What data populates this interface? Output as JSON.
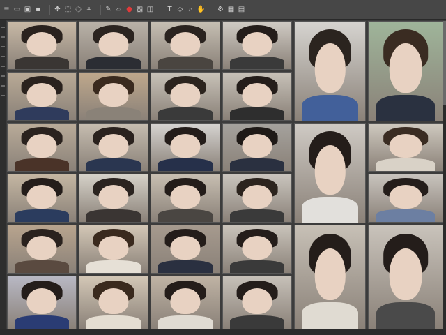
{
  "toolbar": {
    "groups": [
      {
        "items": [
          "menu-icon",
          "new-file-icon",
          "open-icon",
          "save-icon"
        ]
      },
      {
        "items": [
          "move-icon",
          "select-icon",
          "lasso-icon",
          "crop-icon"
        ]
      },
      {
        "items": [
          "brush-icon",
          "eraser-icon",
          "record-icon",
          "image-icon",
          "layer-icon"
        ]
      },
      {
        "items": [
          "text-icon",
          "shape-icon",
          "zoom-icon",
          "hand-icon"
        ]
      },
      {
        "items": [
          "settings-icon",
          "grid-icon",
          "panel-icon"
        ]
      }
    ],
    "accent_color": "#e03a3a"
  },
  "gallery": {
    "background": "#3c3c3c",
    "thumb_count": 32,
    "thumbnails": [
      {
        "name": "portrait-01",
        "tone": "#c8b9a6",
        "hair": "#2a221e",
        "body": "#3a3633",
        "badge": ""
      },
      {
        "name": "portrait-02",
        "tone": "#b9b2a8",
        "hair": "#2b2420",
        "body": "#2b2d33",
        "badge": ""
      },
      {
        "name": "portrait-03",
        "tone": "#c6bfb3",
        "hair": "#2a231f",
        "body": "#4a4540",
        "badge": ""
      },
      {
        "name": "portrait-04",
        "tone": "#d0cbc4",
        "hair": "#241d1a",
        "body": "#3a3a3a",
        "badge": ""
      },
      {
        "name": "portrait-05",
        "tone": "#d6d4d0",
        "hair": "#2b241f",
        "body": "#42609a",
        "badge": ""
      },
      {
        "name": "portrait-06",
        "tone": "#9fb59a",
        "hair": "#3a2c22",
        "body": "#2a3140",
        "badge": ""
      },
      {
        "name": "portrait-07",
        "tone": "#b9aa96",
        "hair": "#2a221e",
        "body": "#2f3b5c",
        "badge": ""
      },
      {
        "name": "portrait-08",
        "tone": "#bfa88c",
        "hair": "#3a2a1e",
        "body": "#8a8278",
        "badge": ""
      },
      {
        "name": "portrait-09",
        "tone": "#c8c2b8",
        "hair": "#2c241e",
        "body": "#3a3a3a",
        "badge": ""
      },
      {
        "name": "portrait-10",
        "tone": "#c7c1b8",
        "hair": "#241d1a",
        "body": "#2e2e2e",
        "badge": ""
      },
      {
        "name": "portrait-11",
        "tone": "#b9ab99",
        "hair": "#2a221e",
        "body": "#4a3328",
        "badge": ""
      },
      {
        "name": "portrait-12",
        "tone": "#c6bdb0",
        "hair": "#2a221e",
        "body": "#2a3650",
        "badge": ""
      },
      {
        "name": "portrait-13",
        "tone": "#d6d4d1",
        "hair": "#241d1a",
        "body": "#26304a",
        "badge": ""
      },
      {
        "name": "portrait-14",
        "tone": "#a5a29d",
        "hair": "#1f1a17",
        "body": "#2a3040",
        "badge": ""
      },
      {
        "name": "portrait-15",
        "tone": "#cfcac4",
        "hair": "#241d1a",
        "body": "#e2e0dc",
        "badge": ""
      },
      {
        "name": "portrait-16",
        "tone": "#cfc9bf",
        "hair": "#3a2c22",
        "body": "#d9d2c7",
        "badge": ""
      },
      {
        "name": "portrait-17",
        "tone": "#c4b6a2",
        "hair": "#241d1a",
        "body": "#2b3c5e",
        "badge": ""
      },
      {
        "name": "portrait-18",
        "tone": "#d5d1c8",
        "hair": "#2b2420",
        "body": "#3a3533",
        "badge": ""
      },
      {
        "name": "portrait-19",
        "tone": "#c7beb1",
        "hair": "#241d1a",
        "body": "#4a4642",
        "badge": ""
      },
      {
        "name": "portrait-20",
        "tone": "#c9c4bd",
        "hair": "#2c241e",
        "body": "#3a3a3a",
        "badge": ""
      },
      {
        "name": "portrait-21",
        "tone": "#c8c3bd",
        "hair": "#241d1a",
        "body": "#6c7fa2",
        "badge": ""
      },
      {
        "name": "portrait-22",
        "tone": "#b8a48e",
        "hair": "#2a221e",
        "body": "#5a4a40",
        "badge": ""
      },
      {
        "name": "portrait-23",
        "tone": "#d3c7b6",
        "hair": "#3a2a1e",
        "body": "#e6e0d6",
        "badge": ""
      },
      {
        "name": "portrait-24",
        "tone": "#a69a8e",
        "hair": "#241d1a",
        "body": "#2a3040",
        "badge": ""
      },
      {
        "name": "portrait-25",
        "tone": "#c9c3ba",
        "hair": "#241d1a",
        "body": "#3a3a3a",
        "badge": ""
      },
      {
        "name": "portrait-26",
        "tone": "#c7c0b6",
        "hair": "#241d1a",
        "body": "#e0dbd2",
        "badge": ""
      },
      {
        "name": "portrait-27",
        "tone": "#c9c3bb",
        "hair": "#241d1a",
        "body": "#4a4a4a",
        "badge": ""
      },
      {
        "name": "portrait-28",
        "tone": "#b8b8c4",
        "hair": "#241d1a",
        "body": "#2a3c74",
        "badge": ""
      },
      {
        "name": "portrait-29",
        "tone": "#d3c7b6",
        "hair": "#3a2a1e",
        "body": "#e4ddd1",
        "badge": ""
      },
      {
        "name": "portrait-30",
        "tone": "#bfb3a4",
        "hair": "#241d1a",
        "body": "#e0dbd2",
        "badge": ""
      },
      {
        "name": "portrait-31",
        "tone": "#c6c0b8",
        "hair": "#241d1a",
        "body": "#3a3a3a",
        "badge": ""
      },
      {
        "name": "portrait-32",
        "tone": "#c7c1b9",
        "hair": "#241d1a",
        "body": "#3a3a3a",
        "badge": ""
      }
    ]
  }
}
